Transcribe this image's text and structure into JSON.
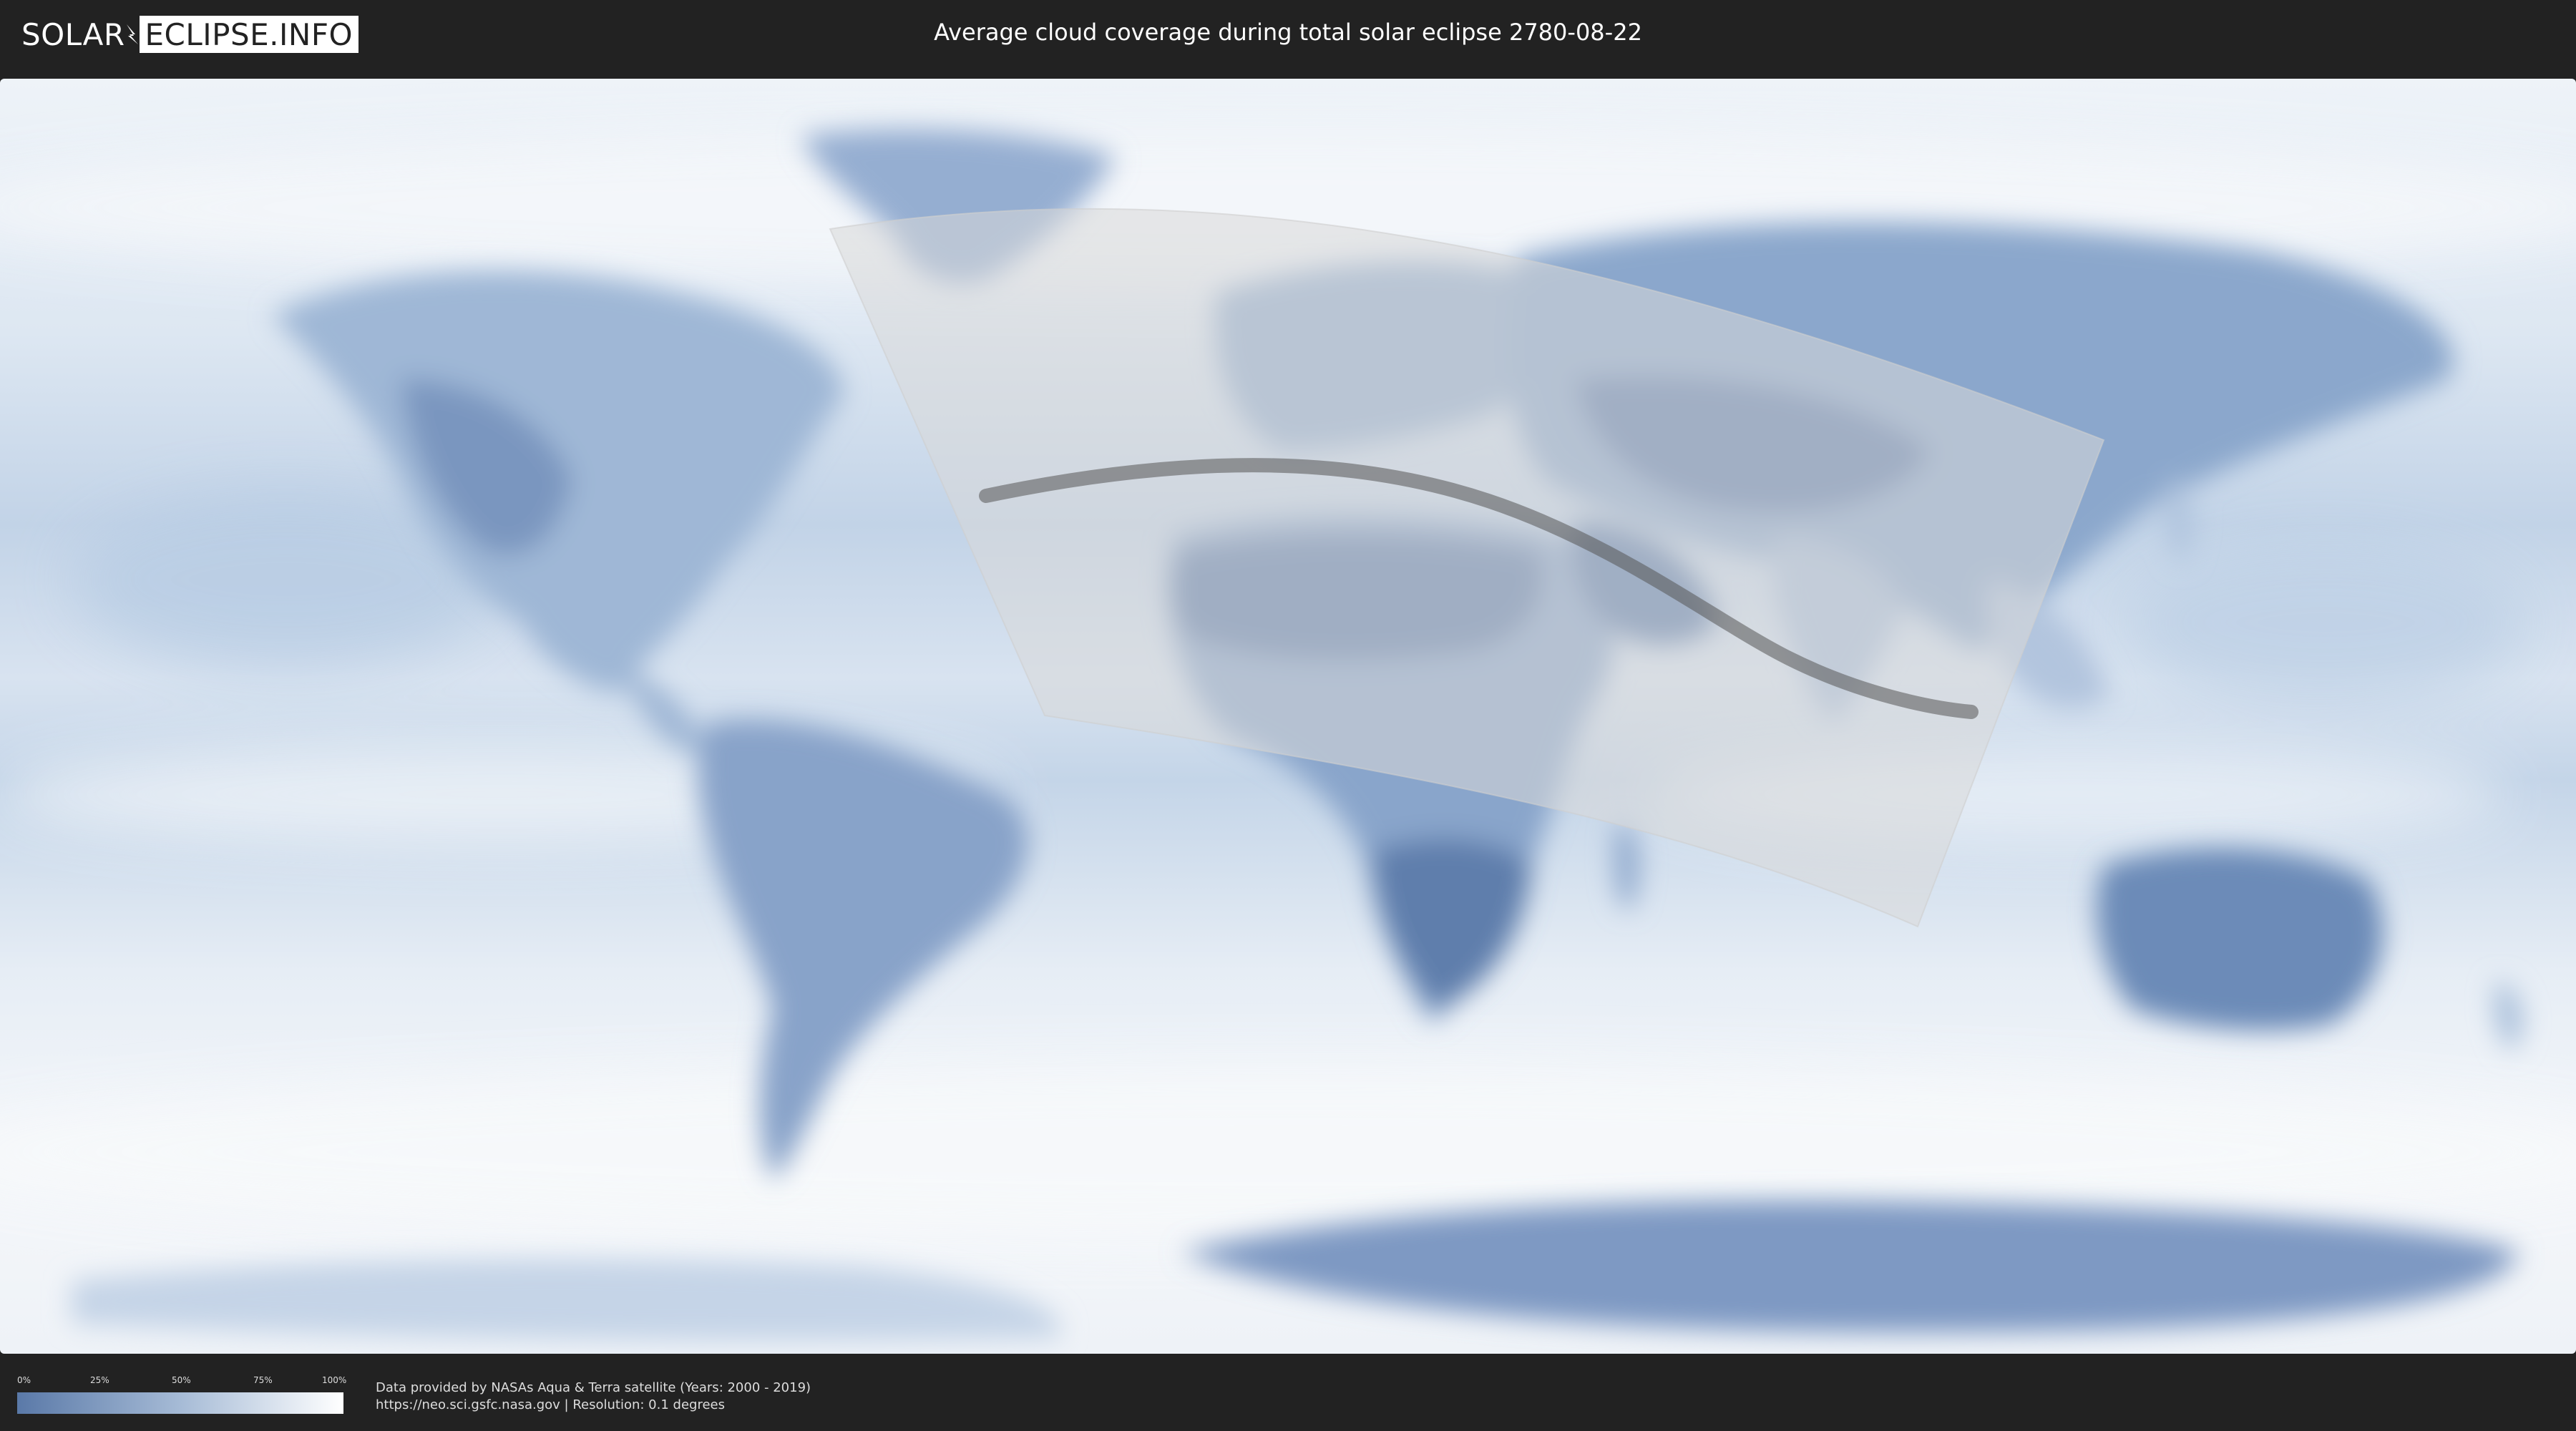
{
  "header": {
    "logo_part1": "SOLAR",
    "logo_part2": "ECLIPSE.INFO",
    "title": "Average cloud coverage during total solar eclipse 2780-08-22"
  },
  "legend": {
    "ticks": [
      "0%",
      "25%",
      "50%",
      "75%",
      "100%"
    ],
    "color_low": "#5a79a8",
    "color_high": "#ffffff"
  },
  "credits": {
    "line1": "Data provided by NASAs Aqua & Terra satellite (Years: 2000 - 2019)",
    "line2": "https://neo.sci.gsfc.nasa.gov | Resolution: 0.1 degrees"
  },
  "colors": {
    "background": "#222222",
    "ocean_clear": "#c9d8ea",
    "cloudy": "#f2f5f9",
    "land_clear": "#6f8db8",
    "visibility_zone": "#d9d9d9",
    "eclipse_path": "#555555"
  }
}
